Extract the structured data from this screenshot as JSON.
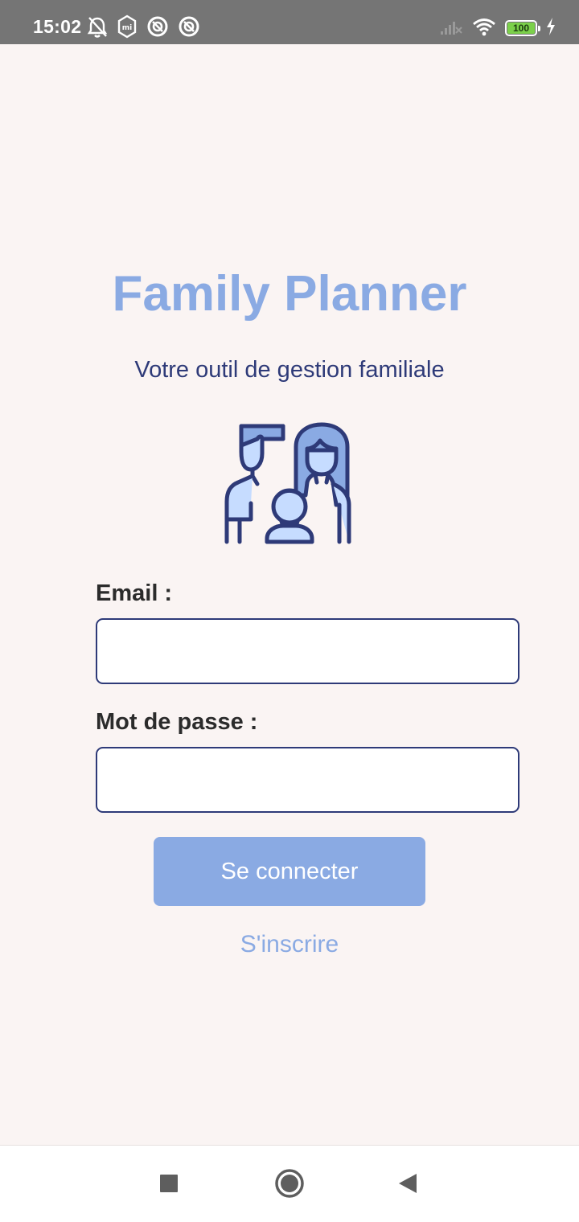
{
  "status_bar": {
    "time": "15:02",
    "battery_level": "100",
    "icons": [
      "alarm-off-icon",
      "mi-icon",
      "app-icon",
      "app-icon",
      "signal-icon",
      "wifi-icon",
      "battery-icon",
      "charging-icon"
    ]
  },
  "app": {
    "title": "Family Planner",
    "subtitle": "Votre outil de gestion familiale"
  },
  "form": {
    "email_label": "Email :",
    "email_value": "",
    "password_label": "Mot de passe :",
    "password_value": "",
    "login_button": "Se connecter",
    "signup_link": "S'inscrire"
  },
  "colors": {
    "accent": "#8aaae3",
    "dark_blue": "#2e3a78",
    "background": "#faf4f3",
    "status_bar": "#757575"
  },
  "nav_bar": {
    "icons": [
      "square-icon",
      "circle-icon",
      "back-triangle-icon"
    ]
  }
}
